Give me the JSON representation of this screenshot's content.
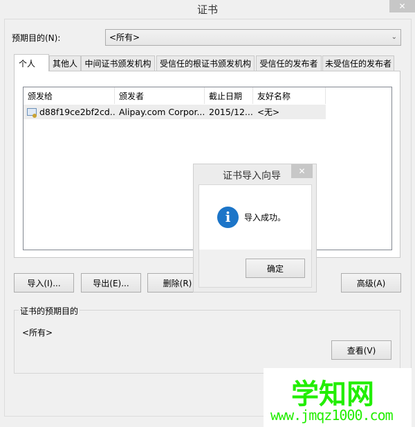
{
  "window": {
    "title": "证书",
    "close": "✕"
  },
  "purpose": {
    "label": "预期目的(N):",
    "value": "<所有>"
  },
  "tabs": [
    "个人",
    "其他人",
    "中间证书颁发机构",
    "受信任的根证书颁发机构",
    "受信任的发布者",
    "未受信任的发布者"
  ],
  "table": {
    "columns": [
      "颁发给",
      "颁发者",
      "截止日期",
      "友好名称"
    ],
    "rows": [
      [
        "d88f19ce2bf2cd...",
        "Alipay.com Corpor...",
        "2015/12...",
        "<无>"
      ]
    ]
  },
  "buttons": {
    "import": "导入(I)...",
    "export": "导出(E)...",
    "remove": "删除(R)",
    "advanced": "高级(A)",
    "view": "查看(V)"
  },
  "group": {
    "title": "证书的预期目的",
    "value": "<所有>"
  },
  "dialog": {
    "title": "证书导入向导",
    "close": "✕",
    "message": "导入成功。",
    "ok": "确定"
  },
  "watermark": {
    "title": "学知网",
    "url": "www.jmqz1000.com"
  }
}
